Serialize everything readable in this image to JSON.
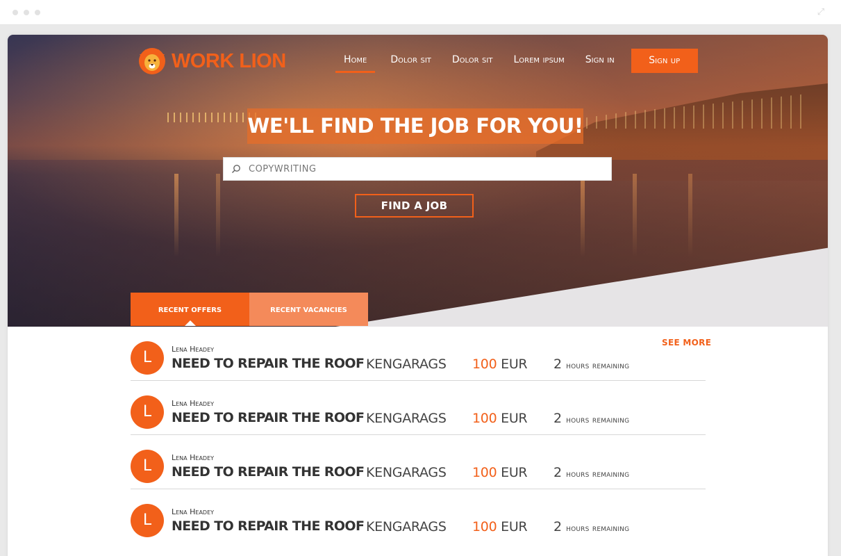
{
  "colors": {
    "accent": "#f2601a",
    "accent_light": "#f48a5a",
    "text": "#333333"
  },
  "brand": {
    "name": "WORK LION",
    "logo_icon": "lion-head-icon"
  },
  "nav": {
    "items": [
      {
        "label": "Home",
        "active": true
      },
      {
        "label": "Dolor sit",
        "active": false
      },
      {
        "label": "Dolor sit",
        "active": false
      },
      {
        "label": "Lorem ipsum",
        "active": false
      },
      {
        "label": "Sign in",
        "active": false
      }
    ],
    "signup_label": "Sign up"
  },
  "hero": {
    "headline": "WE'LL FIND THE JOB FOR YOU!",
    "search": {
      "value": "",
      "placeholder": "COPYWRITING",
      "icon": "search-icon"
    },
    "find_label": "FIND A JOB"
  },
  "tabs": [
    {
      "label": "RECENT OFFERS",
      "active": true
    },
    {
      "label": "RECENT VACANCIES",
      "active": false
    }
  ],
  "see_more": "SEE MORE",
  "listings": [
    {
      "initial": "L",
      "author": "Lena Headey",
      "title": "NEED TO REPAIR THE ROOF",
      "company": "KENGARAGS",
      "price": "100",
      "currency": "EUR",
      "time_num": "2",
      "time_text": "hours remaining"
    },
    {
      "initial": "L",
      "author": "Lena Headey",
      "title": "NEED TO REPAIR THE ROOF",
      "company": "KENGARAGS",
      "price": "100",
      "currency": "EUR",
      "time_num": "2",
      "time_text": "hours remaining"
    },
    {
      "initial": "L",
      "author": "Lena Headey",
      "title": "NEED TO REPAIR THE ROOF",
      "company": "KENGARAGS",
      "price": "100",
      "currency": "EUR",
      "time_num": "2",
      "time_text": "hours remaining"
    },
    {
      "initial": "L",
      "author": "Lena Headey",
      "title": "NEED TO REPAIR THE ROOF",
      "company": "KENGARAGS",
      "price": "100",
      "currency": "EUR",
      "time_num": "2",
      "time_text": "hours remaining"
    }
  ]
}
